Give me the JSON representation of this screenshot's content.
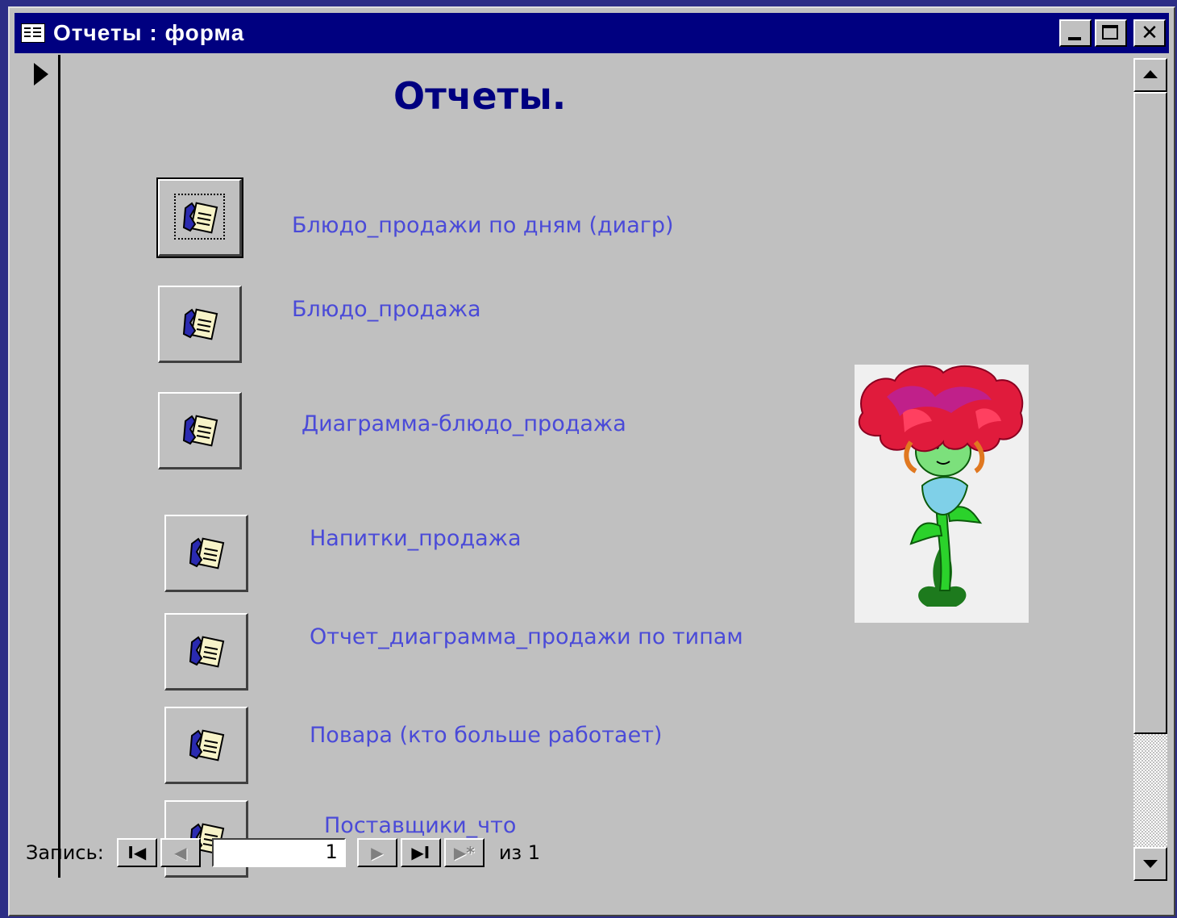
{
  "window": {
    "title": "Отчеты : форма",
    "minimize_label": "",
    "maximize_label": "",
    "close_label": "✕"
  },
  "form": {
    "heading": "Отчеты.",
    "reports": [
      {
        "label": "Блюдо_продажи по дням (диагр)"
      },
      {
        "label": "Блюдо_продажа"
      },
      {
        "label": "Диаграмма-блюдо_продажа"
      },
      {
        "label": "Напитки_продажа"
      },
      {
        "label": "Отчет_диаграмма_продажи по типам"
      },
      {
        "label": "Повара (кто больше работает)"
      },
      {
        "label": "Поставщики_что"
      }
    ]
  },
  "navigation": {
    "record_label": "Запись:",
    "first": "I◀",
    "prev": "◀",
    "current_record": "1",
    "next": "▶",
    "last": "▶I",
    "new": "▶*",
    "of_label": "из  1"
  },
  "colors": {
    "desktop": "#2c2d86",
    "titlebar": "#000080",
    "window": "#c0c0c0",
    "heading": "#000080",
    "report_label": "#4a4ad8"
  },
  "icons": {
    "report_button": "report-icon",
    "picture": "flower-clipart"
  }
}
